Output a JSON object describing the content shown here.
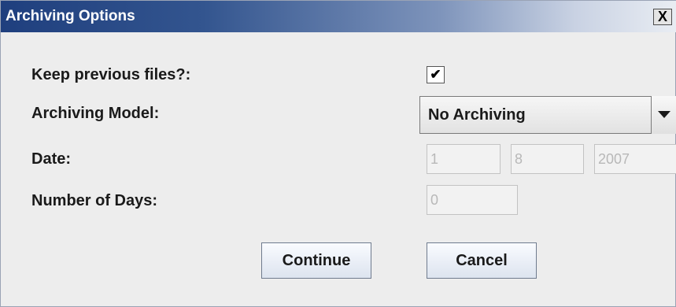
{
  "dialog": {
    "title": "Archiving Options",
    "close_label": "X"
  },
  "form": {
    "keep_previous_label": "Keep previous files?:",
    "keep_previous_checked": true,
    "checkbox_mark": "✔",
    "archiving_model_label": "Archiving Model:",
    "archiving_model_value": "No Archiving",
    "date_label": "Date:",
    "date_day": "1",
    "date_month": "8",
    "date_year": "2007",
    "days_label": "Number of Days:",
    "days_value": "0"
  },
  "buttons": {
    "continue": "Continue",
    "cancel": "Cancel"
  },
  "colors": {
    "title_bar_start": "#1f3f7e",
    "title_bar_end": "#e9edf3",
    "dialog_bg": "#ededed",
    "disabled_text": "#b8b8b8"
  }
}
